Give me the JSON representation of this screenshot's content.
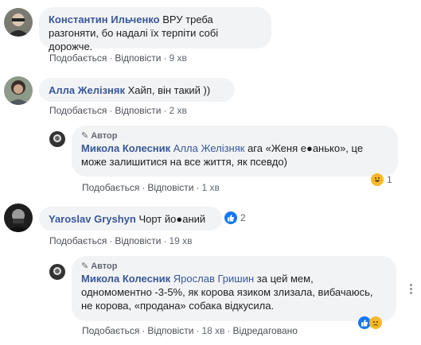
{
  "actions": {
    "like": "Подобається",
    "reply": "Відповісти",
    "separator": "·",
    "edited": "Відредаговано"
  },
  "badge": {
    "author": "Автор",
    "icon": "pencil-icon"
  },
  "comments": [
    {
      "author": "Константин Ильченко",
      "text": "ВРУ треба разгоняти, бо надалі їх терпіти собі дорожче.",
      "time": "9 хв"
    },
    {
      "author": "Алла Желізняк",
      "text": "Хайп, він такий ))",
      "time": "2 хв"
    },
    {
      "author": "Микола Колесник",
      "tag": "Алла Желізняк",
      "text": "ага «Женя е●анько», це може залишитися на все життя, як псевдо)",
      "time": "1 хв",
      "reaction_count": "1"
    },
    {
      "author": "Yaroslav Gryshyn",
      "text": "Чорт йо●аний",
      "time": "19 хв",
      "reaction_count": "2"
    },
    {
      "author": "Микола Колесник",
      "tag": "Ярослав Гришин",
      "text": "за цей мем, одномоментно -3-5%, як корова язиком злизала, вибачаюсь, не корова, «продана» собака відкусила.",
      "time": "18 хв"
    }
  ],
  "colors": {
    "link": "#385898",
    "bubble": "#f2f3f5",
    "like_blue": "#1877f2",
    "haha_yellow": "#f7b928"
  }
}
